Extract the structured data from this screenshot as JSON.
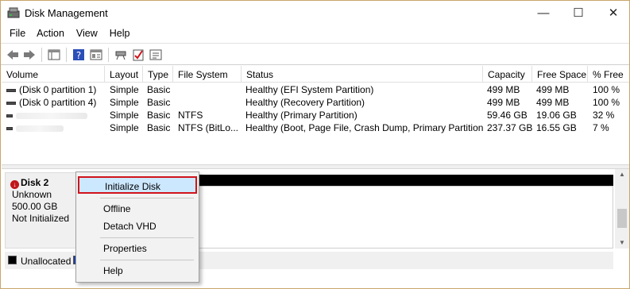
{
  "window": {
    "title": "Disk Management",
    "controls": {
      "minimize": "—",
      "maximize": "☐",
      "close": "✕"
    }
  },
  "menu": [
    "File",
    "Action",
    "View",
    "Help"
  ],
  "toolbar": {
    "icons": [
      "back-arrow-icon",
      "forward-arrow-icon",
      "console-tree-icon",
      "help-icon",
      "properties-icon",
      "connect-icon",
      "check-icon",
      "list-icon"
    ]
  },
  "volumes": {
    "columns": [
      "Volume",
      "Layout",
      "Type",
      "File System",
      "Status",
      "Capacity",
      "Free Space",
      "% Free"
    ],
    "rows": [
      [
        "(Disk 0 partition 1)",
        "Simple",
        "Basic",
        "",
        "Healthy (EFI System Partition)",
        "499 MB",
        "499 MB",
        "100 %"
      ],
      [
        "(Disk 0 partition 4)",
        "Simple",
        "Basic",
        "",
        "Healthy (Recovery Partition)",
        "499 MB",
        "499 MB",
        "100 %"
      ],
      [
        "",
        "Simple",
        "Basic",
        "NTFS",
        "Healthy (Primary Partition)",
        "59.46 GB",
        "19.06 GB",
        "32 %"
      ],
      [
        "",
        "Simple",
        "Basic",
        "NTFS (BitLo...",
        "Healthy (Boot, Page File, Crash Dump, Primary Partition)",
        "237.37 GB",
        "16.55 GB",
        "7 %"
      ]
    ]
  },
  "disk": {
    "name": "Disk 2",
    "kind": "Unknown",
    "size": "500.00 GB",
    "state": "Not Initialized"
  },
  "legend": {
    "unallocated": "Unallocated"
  },
  "context_menu": {
    "items": [
      "Initialize Disk",
      "Offline",
      "Detach VHD",
      "Properties",
      "Help"
    ],
    "highlighted": "Initialize Disk"
  },
  "colors": {
    "highlight_border": "#d0141c",
    "highlight_fill": "#cce8ff",
    "unallocated": "#000000",
    "primary_partition": "#1f3ea0"
  }
}
